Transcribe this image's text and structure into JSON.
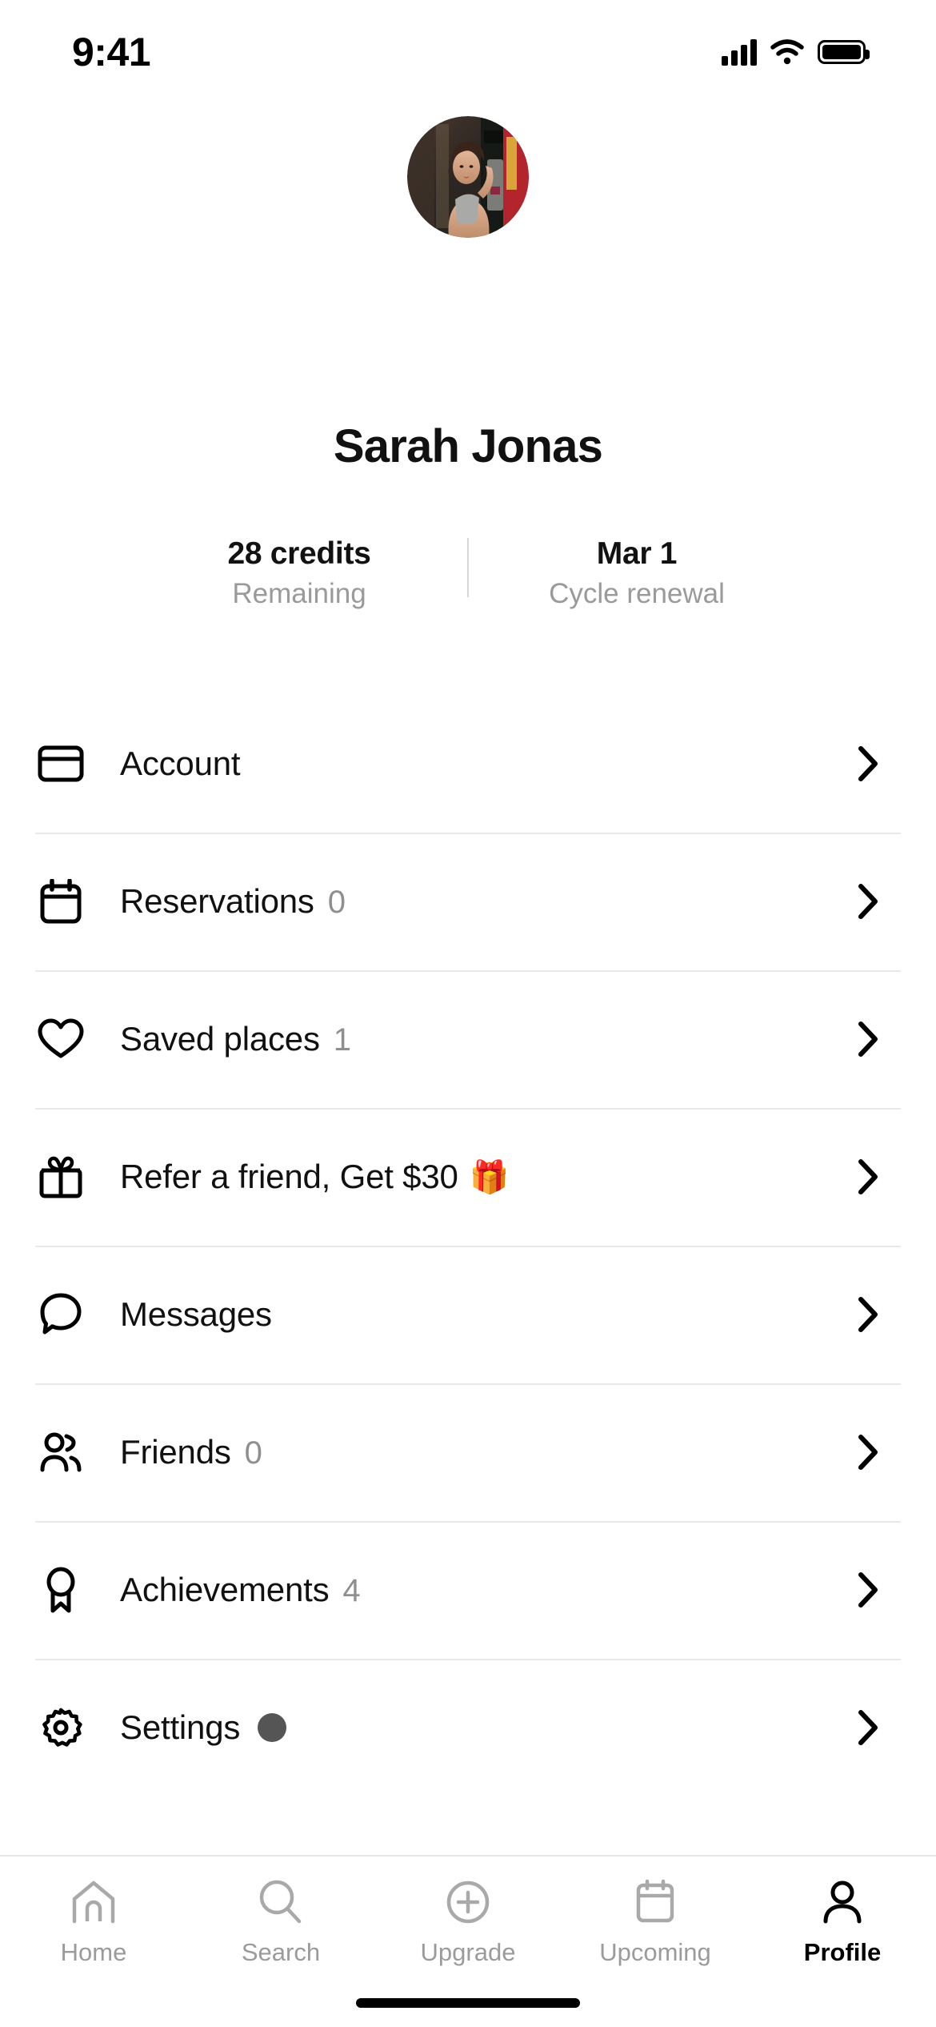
{
  "status_bar": {
    "time": "9:41",
    "cellular_icon": "signal-bars-icon",
    "wifi_icon": "wifi-icon",
    "battery_icon": "battery-full-icon"
  },
  "profile": {
    "avatar_alt": "user-avatar-photo",
    "name": "Sarah Jonas"
  },
  "stats": [
    {
      "value": "28 credits",
      "label": "Remaining"
    },
    {
      "value": "Mar 1",
      "label": "Cycle renewal"
    }
  ],
  "menu": [
    {
      "icon": "credit-card-icon",
      "label": "Account",
      "count": "",
      "emoji": "",
      "dot": false,
      "chevron": "chevron-right-icon"
    },
    {
      "icon": "calendar-icon",
      "label": "Reservations",
      "count": "0",
      "emoji": "",
      "dot": false,
      "chevron": "chevron-right-icon"
    },
    {
      "icon": "heart-icon",
      "label": "Saved places",
      "count": "1",
      "emoji": "",
      "dot": false,
      "chevron": "chevron-right-icon"
    },
    {
      "icon": "gift-icon",
      "label": "Refer a friend, Get $30",
      "count": "",
      "emoji": "🎁",
      "dot": false,
      "chevron": "chevron-right-icon"
    },
    {
      "icon": "chat-bubble-icon",
      "label": "Messages",
      "count": "",
      "emoji": "",
      "dot": false,
      "chevron": "chevron-right-icon"
    },
    {
      "icon": "people-icon",
      "label": "Friends",
      "count": "0",
      "emoji": "",
      "dot": false,
      "chevron": "chevron-right-icon"
    },
    {
      "icon": "award-icon",
      "label": "Achievements",
      "count": "4",
      "emoji": "",
      "dot": false,
      "chevron": "chevron-right-icon"
    },
    {
      "icon": "gear-icon",
      "label": "Settings",
      "count": "",
      "emoji": "",
      "dot": true,
      "chevron": "chevron-right-icon"
    }
  ],
  "tabbar": [
    {
      "icon": "home-icon",
      "label": "Home",
      "active": false
    },
    {
      "icon": "search-icon",
      "label": "Search",
      "active": false
    },
    {
      "icon": "plus-circle-icon",
      "label": "Upgrade",
      "active": false
    },
    {
      "icon": "calendar-icon",
      "label": "Upcoming",
      "active": false
    },
    {
      "icon": "person-icon",
      "label": "Profile",
      "active": true
    }
  ],
  "colors": {
    "text_primary": "#111111",
    "text_muted": "#9a9a9a",
    "divider": "#e8e8e8",
    "badge_dot": "#555555",
    "tab_inactive": "#9b9b9b",
    "tab_active": "#000000"
  }
}
